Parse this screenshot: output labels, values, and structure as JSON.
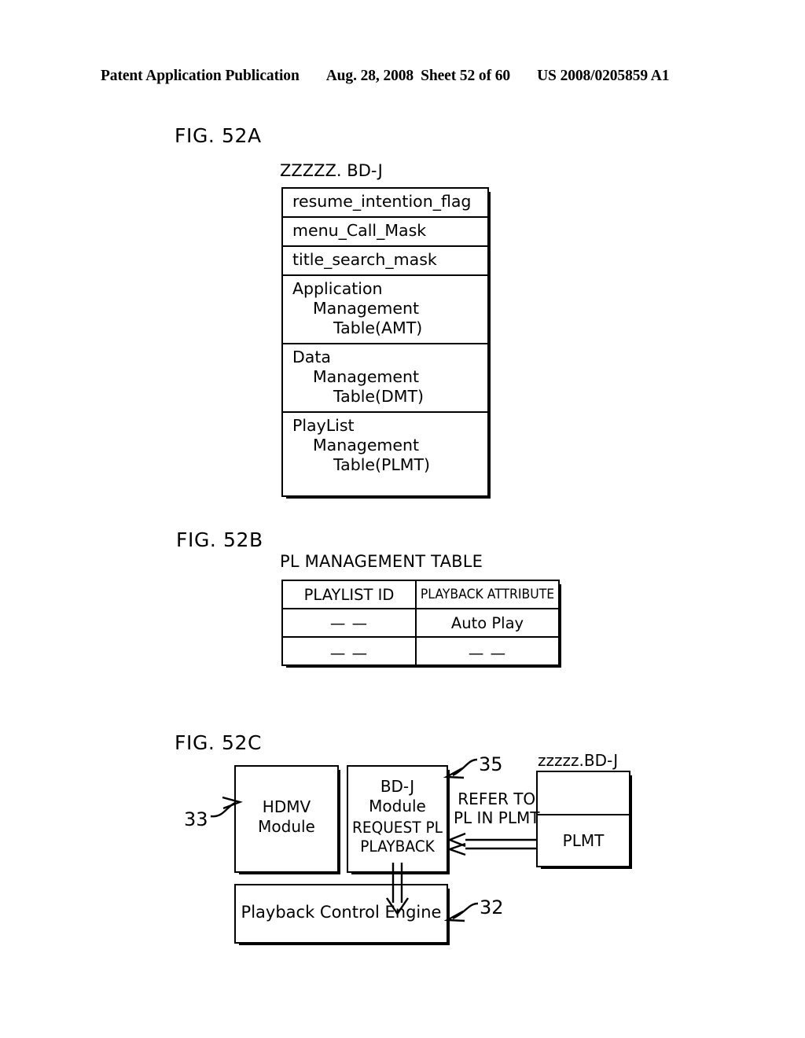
{
  "header": {
    "publication": "Patent Application Publication",
    "date": "Aug. 28, 2008",
    "sheet": "Sheet 52 of 60",
    "doc_number": "US 2008/0205859 A1"
  },
  "figures": {
    "fig52a": {
      "label": "FIG. 52A",
      "caption": "ZZZZZ. BD-J",
      "rows": [
        {
          "line1": "resume_intention_flag",
          "line2": "",
          "line3": ""
        },
        {
          "line1": "menu_Call_Mask",
          "line2": "",
          "line3": ""
        },
        {
          "line1": "title_search_mask",
          "line2": "",
          "line3": ""
        },
        {
          "line1": "Application",
          "line2": "Management",
          "line3": "Table(AMT)"
        },
        {
          "line1": "Data",
          "line2": "Management",
          "line3": "Table(DMT)"
        },
        {
          "line1": "PlayList",
          "line2": "Management",
          "line3": "Table(PLMT)"
        }
      ]
    },
    "fig52b": {
      "label": "FIG. 52B",
      "caption": "PL MANAGEMENT TABLE",
      "columns": [
        "PLAYLIST ID",
        "PLAYBACK ATTRIBUTE"
      ],
      "rows": [
        [
          "— —",
          "Auto Play"
        ],
        [
          "— —",
          "— —"
        ]
      ]
    },
    "fig52c": {
      "label": "FIG. 52C",
      "hdmv_module": "HDMV\nModule",
      "hdmv_module_line1": "HDMV",
      "hdmv_module_line2": "Module",
      "bdj_module_line1": "BD-J",
      "bdj_module_line2": "Module",
      "bdj_request_line1": "REQUEST PL",
      "bdj_request_line2": "PLAYBACK",
      "playback_control_engine": "Playback Control Engine",
      "refer_label_line1": "REFER TO",
      "refer_label_line2": "PL IN PLMT",
      "file_label": "zzzzz.BD-J",
      "plmt_cell": "PLMT",
      "ref_33": "33",
      "ref_35": "35",
      "ref_32": "32"
    }
  },
  "colors": {
    "ink": "#000000",
    "paper": "#ffffff"
  }
}
